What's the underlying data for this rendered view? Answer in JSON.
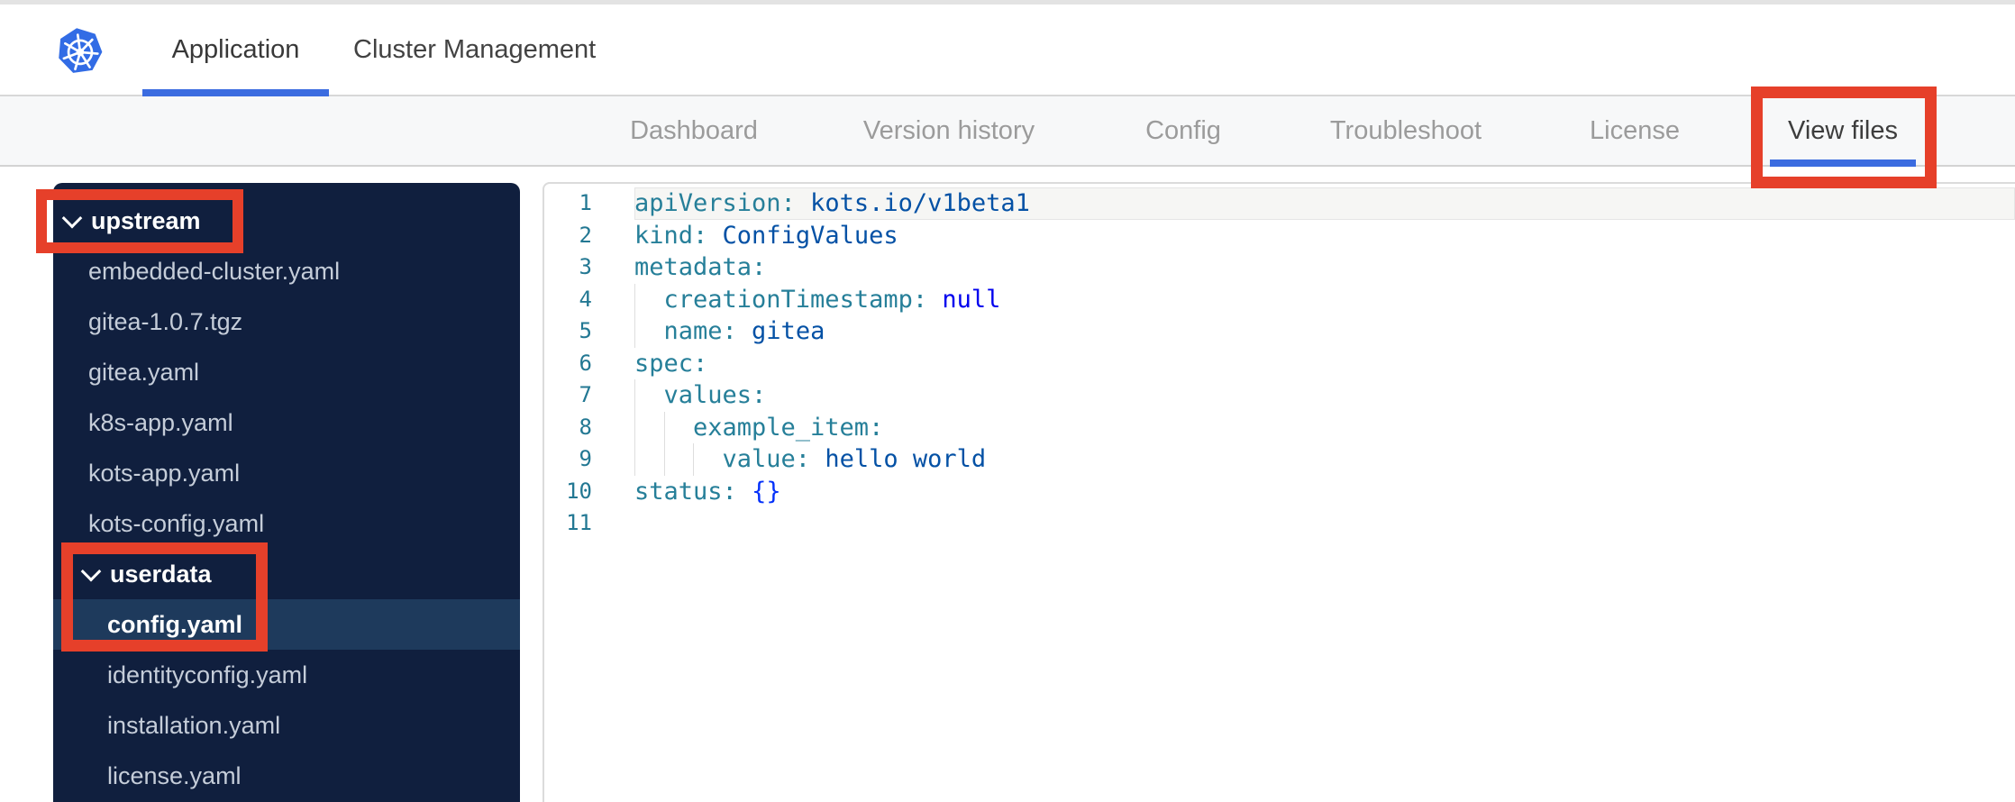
{
  "header": {
    "tabs": [
      {
        "label": "Application",
        "active": true
      },
      {
        "label": "Cluster Management",
        "active": false
      }
    ]
  },
  "nav": {
    "items": [
      {
        "label": "Dashboard",
        "active": false
      },
      {
        "label": "Version history",
        "active": false
      },
      {
        "label": "Config",
        "active": false
      },
      {
        "label": "Troubleshoot",
        "active": false
      },
      {
        "label": "License",
        "active": false
      },
      {
        "label": "View files",
        "active": true
      }
    ]
  },
  "file_tree": {
    "items": [
      {
        "label": "upstream",
        "type": "folder",
        "level": 0,
        "expanded": true
      },
      {
        "label": "embedded-cluster.yaml",
        "type": "file",
        "level": 1
      },
      {
        "label": "gitea-1.0.7.tgz",
        "type": "file",
        "level": 1
      },
      {
        "label": "gitea.yaml",
        "type": "file",
        "level": 1
      },
      {
        "label": "k8s-app.yaml",
        "type": "file",
        "level": 1
      },
      {
        "label": "kots-app.yaml",
        "type": "file",
        "level": 1
      },
      {
        "label": "kots-config.yaml",
        "type": "file",
        "level": 1
      },
      {
        "label": "userdata",
        "type": "folder",
        "level": 1,
        "expanded": true
      },
      {
        "label": "config.yaml",
        "type": "file",
        "level": 2,
        "selected": true
      },
      {
        "label": "identityconfig.yaml",
        "type": "file",
        "level": 2
      },
      {
        "label": "installation.yaml",
        "type": "file",
        "level": 2
      },
      {
        "label": "license.yaml",
        "type": "file",
        "level": 2
      }
    ]
  },
  "editor": {
    "language": "yaml",
    "lines": [
      {
        "n": 1,
        "indent": 0,
        "current": true,
        "tokens": [
          {
            "t": "key",
            "s": "apiVersion:"
          },
          {
            "t": "sp",
            "s": " "
          },
          {
            "t": "val",
            "s": "kots.io/v1beta1"
          }
        ]
      },
      {
        "n": 2,
        "indent": 0,
        "tokens": [
          {
            "t": "key",
            "s": "kind:"
          },
          {
            "t": "sp",
            "s": " "
          },
          {
            "t": "val",
            "s": "ConfigValues"
          }
        ]
      },
      {
        "n": 3,
        "indent": 0,
        "tokens": [
          {
            "t": "key",
            "s": "metadata:"
          }
        ]
      },
      {
        "n": 4,
        "indent": 1,
        "tokens": [
          {
            "t": "key",
            "s": "creationTimestamp:"
          },
          {
            "t": "sp",
            "s": " "
          },
          {
            "t": "kw",
            "s": "null"
          }
        ]
      },
      {
        "n": 5,
        "indent": 1,
        "tokens": [
          {
            "t": "key",
            "s": "name:"
          },
          {
            "t": "sp",
            "s": " "
          },
          {
            "t": "val",
            "s": "gitea"
          }
        ]
      },
      {
        "n": 6,
        "indent": 0,
        "tokens": [
          {
            "t": "key",
            "s": "spec:"
          }
        ]
      },
      {
        "n": 7,
        "indent": 1,
        "tokens": [
          {
            "t": "key",
            "s": "values:"
          }
        ]
      },
      {
        "n": 8,
        "indent": 2,
        "tokens": [
          {
            "t": "key",
            "s": "example_item:"
          }
        ]
      },
      {
        "n": 9,
        "indent": 3,
        "tokens": [
          {
            "t": "key",
            "s": "value:"
          },
          {
            "t": "sp",
            "s": " "
          },
          {
            "t": "val",
            "s": "hello world"
          }
        ]
      },
      {
        "n": 10,
        "indent": 0,
        "tokens": [
          {
            "t": "key",
            "s": "status:"
          },
          {
            "t": "sp",
            "s": " "
          },
          {
            "t": "br",
            "s": "{}"
          }
        ]
      },
      {
        "n": 11,
        "indent": 0,
        "tokens": []
      }
    ],
    "colors": {
      "key": "#267f99",
      "value": "#0451a5",
      "keyword": "#0000ee",
      "bracket": "#0431fa",
      "line_number": "#237893"
    }
  },
  "annotations": {
    "color": "#e6402a",
    "boxes": [
      "upstream-folder",
      "userdata-config-file",
      "view-files-tab"
    ]
  },
  "theme": {
    "sidebar_bg": "#101f3e",
    "sidebar_selected_bg": "#1e3a5c",
    "accent_blue": "#3b6ce0",
    "logo_blue": "#326ce5",
    "nav_bg": "#f7f8f9"
  }
}
